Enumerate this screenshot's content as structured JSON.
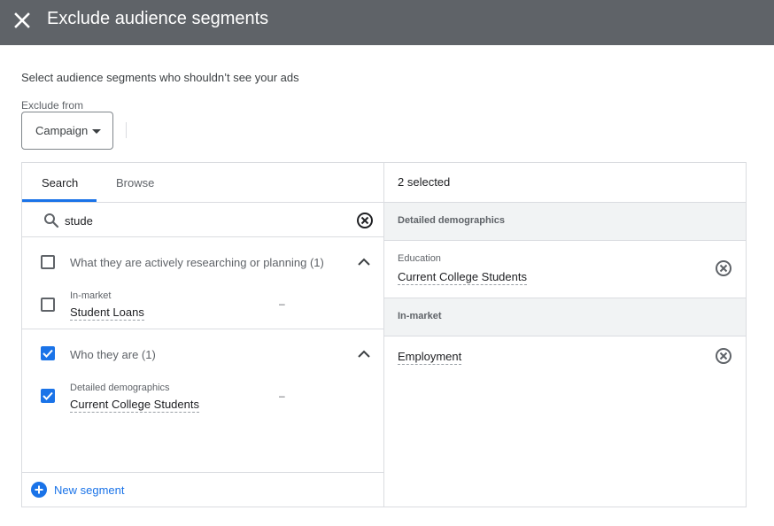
{
  "header": {
    "title": "Exclude audience segments",
    "close_icon": "close-icon"
  },
  "subtitle": "Select audience segments who shouldn’t see your ads",
  "exclude_from": {
    "label": "Exclude from",
    "value": "Campaign"
  },
  "left_panel": {
    "tabs": [
      {
        "label": "Search",
        "active": true
      },
      {
        "label": "Browse",
        "active": false
      }
    ],
    "search": {
      "value": "stude",
      "icon": "search-icon",
      "clear_icon": "clear-icon"
    },
    "groups": [
      {
        "label": "What they are actively researching or planning (1)",
        "checked": false,
        "items": [
          {
            "category": "In-market",
            "name": "Student Loans",
            "value": "–",
            "checked": false
          }
        ]
      },
      {
        "label": "Who they are (1)",
        "checked": true,
        "items": [
          {
            "category": "Detailed demographics",
            "name": "Current College Students",
            "value": "–",
            "checked": true
          }
        ]
      }
    ],
    "new_segment_label": "New segment"
  },
  "right_panel": {
    "selected_count": "2 selected",
    "sections": [
      {
        "heading": "Detailed demographics",
        "items": [
          {
            "sub": "Education",
            "name": "Current College Students"
          }
        ]
      },
      {
        "heading": "In-market",
        "items": [
          {
            "sub": "",
            "name": "Employment"
          }
        ]
      }
    ]
  },
  "colors": {
    "header_bg": "#5f6368",
    "accent": "#1a73e8",
    "section_bg": "#f1f3f4"
  }
}
